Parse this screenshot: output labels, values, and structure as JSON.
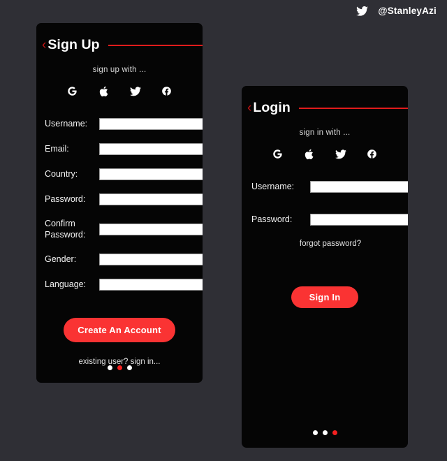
{
  "colors": {
    "background": "#2f2f35",
    "card": "#050505",
    "accent_red": "#fa3333",
    "rule_red": "#e01b1b",
    "text": "#ffffff"
  },
  "watermark": {
    "icon": "twitter-bird-icon",
    "handle": "@StanleyAzi"
  },
  "signup_card": {
    "back_icon": "chevron-left-icon",
    "title": "Sign Up",
    "social_label": "sign up with ...",
    "social_icons": [
      {
        "name": "google-icon",
        "label": "G"
      },
      {
        "name": "apple-icon",
        "label": "Apple"
      },
      {
        "name": "twitter-icon",
        "label": "Twitter"
      },
      {
        "name": "facebook-icon",
        "label": "f"
      }
    ],
    "fields": [
      {
        "label": "Username:",
        "value": "",
        "placeholder": ""
      },
      {
        "label": "Email:",
        "value": "",
        "placeholder": ""
      },
      {
        "label": "Country:",
        "value": "",
        "placeholder": ""
      },
      {
        "label": "Password:",
        "value": "",
        "placeholder": ""
      },
      {
        "label": "Confirm Password:",
        "value": "",
        "placeholder": ""
      },
      {
        "label": "Gender:",
        "value": "",
        "placeholder": ""
      },
      {
        "label": "Language:",
        "value": "",
        "placeholder": ""
      }
    ],
    "submit_label": "Create An Account",
    "footer_note": "existing user? sign in...",
    "pager": {
      "count": 3,
      "active_index": 1
    }
  },
  "login_card": {
    "back_icon": "chevron-left-icon",
    "title": "Login",
    "social_label": "sign in with ...",
    "social_icons": [
      {
        "name": "google-icon",
        "label": "G"
      },
      {
        "name": "apple-icon",
        "label": "Apple"
      },
      {
        "name": "twitter-icon",
        "label": "Twitter"
      },
      {
        "name": "facebook-icon",
        "label": "f"
      }
    ],
    "fields": [
      {
        "label": "Username:",
        "value": "",
        "placeholder": ""
      },
      {
        "label": "Password:",
        "value": "",
        "placeholder": ""
      }
    ],
    "forgot_label": "forgot password?",
    "submit_label": "Sign In",
    "pager": {
      "count": 3,
      "active_index": 2
    }
  }
}
